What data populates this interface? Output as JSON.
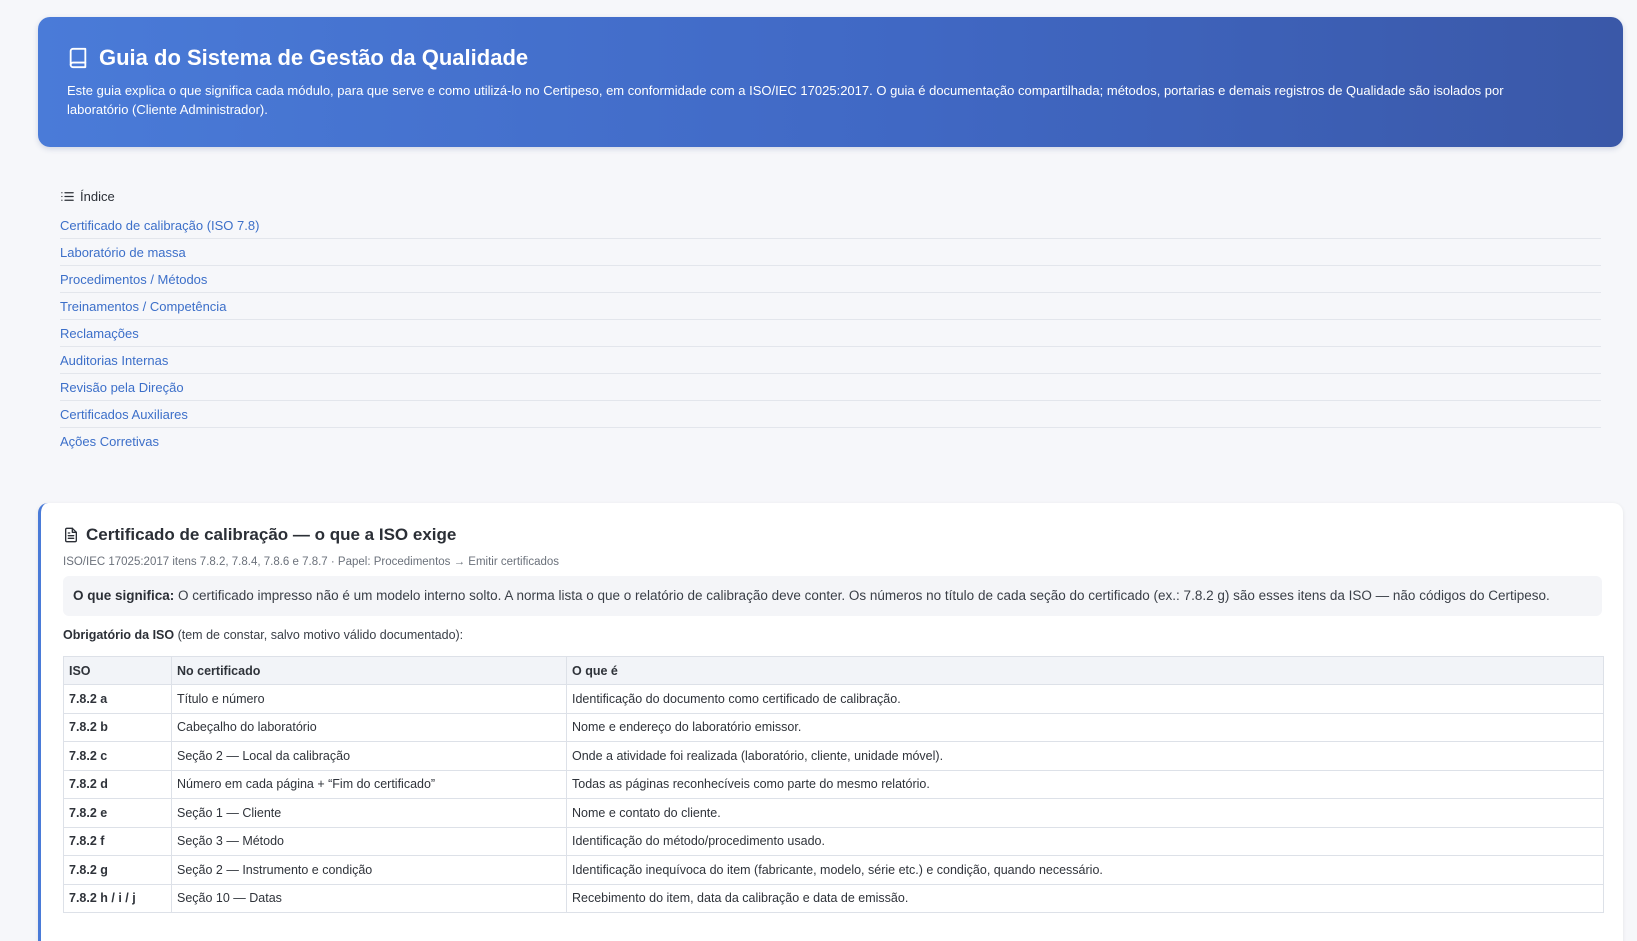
{
  "hero": {
    "title": "Guia do Sistema de Gestão da Qualidade",
    "description": "Este guia explica o que significa cada módulo, para que serve e como utilizá-lo no Certipeso, em conformidade com a ISO/IEC 17025:2017. O guia é documentação compartilhada; métodos, portarias e demais registros de Qualidade são isolados por laboratório (Cliente Administrador).",
    "icon": "book-icon"
  },
  "toc": {
    "heading": "Índice",
    "icon": "list-icon",
    "items": [
      "Certificado de calibração (ISO 7.8)",
      "Laboratório de massa",
      "Procedimentos / Métodos",
      "Treinamentos / Competência",
      "Reclamações",
      "Auditorias Internas",
      "Revisão pela Direção",
      "Certificados Auxiliares",
      "Ações Corretivas"
    ]
  },
  "section": {
    "title": "Certificado de calibração — o que a ISO exige",
    "icon": "document-icon",
    "meta": "ISO/IEC 17025:2017 itens 7.8.2, 7.8.4, 7.8.6 e 7.8.7 · Papel: Procedimentos → Emitir certificados",
    "note_label": "O que significa:",
    "note_text": " O certificado impresso não é um modelo interno solto. A norma lista o que o relatório de calibração deve conter. Os números no título de cada seção do certificado (ex.: 7.8.2 g) são esses itens da ISO — não códigos do Certipeso.",
    "mandatory_label": "Obrigatório da ISO",
    "mandatory_text": " (tem de constar, salvo motivo válido documentado):",
    "table": {
      "headers": [
        "ISO",
        "No certificado",
        "O que é"
      ],
      "rows": [
        [
          "7.8.2 a",
          "Título e número",
          "Identificação do documento como certificado de calibração."
        ],
        [
          "7.8.2 b",
          "Cabeçalho do laboratório",
          "Nome e endereço do laboratório emissor."
        ],
        [
          "7.8.2 c",
          "Seção 2 — Local da calibração",
          "Onde a atividade foi realizada (laboratório, cliente, unidade móvel)."
        ],
        [
          "7.8.2 d",
          "Número em cada página + “Fim do certificado”",
          "Todas as páginas reconhecíveis como parte do mesmo relatório."
        ],
        [
          "7.8.2 e",
          "Seção 1 — Cliente",
          "Nome e contato do cliente."
        ],
        [
          "7.8.2 f",
          "Seção 3 — Método",
          "Identificação do método/procedimento usado."
        ],
        [
          "7.8.2 g",
          "Seção 2 — Instrumento e condição",
          "Identificação inequívoca do item (fabricante, modelo, série etc.) e condição, quando necessário."
        ],
        [
          "7.8.2 h / i / j",
          "Seção 10 — Datas",
          "Recebimento do item, data da calibração e data de emissão."
        ]
      ]
    }
  },
  "colors": {
    "accent": "#4a7bd8",
    "link": "#3c6fc9"
  }
}
